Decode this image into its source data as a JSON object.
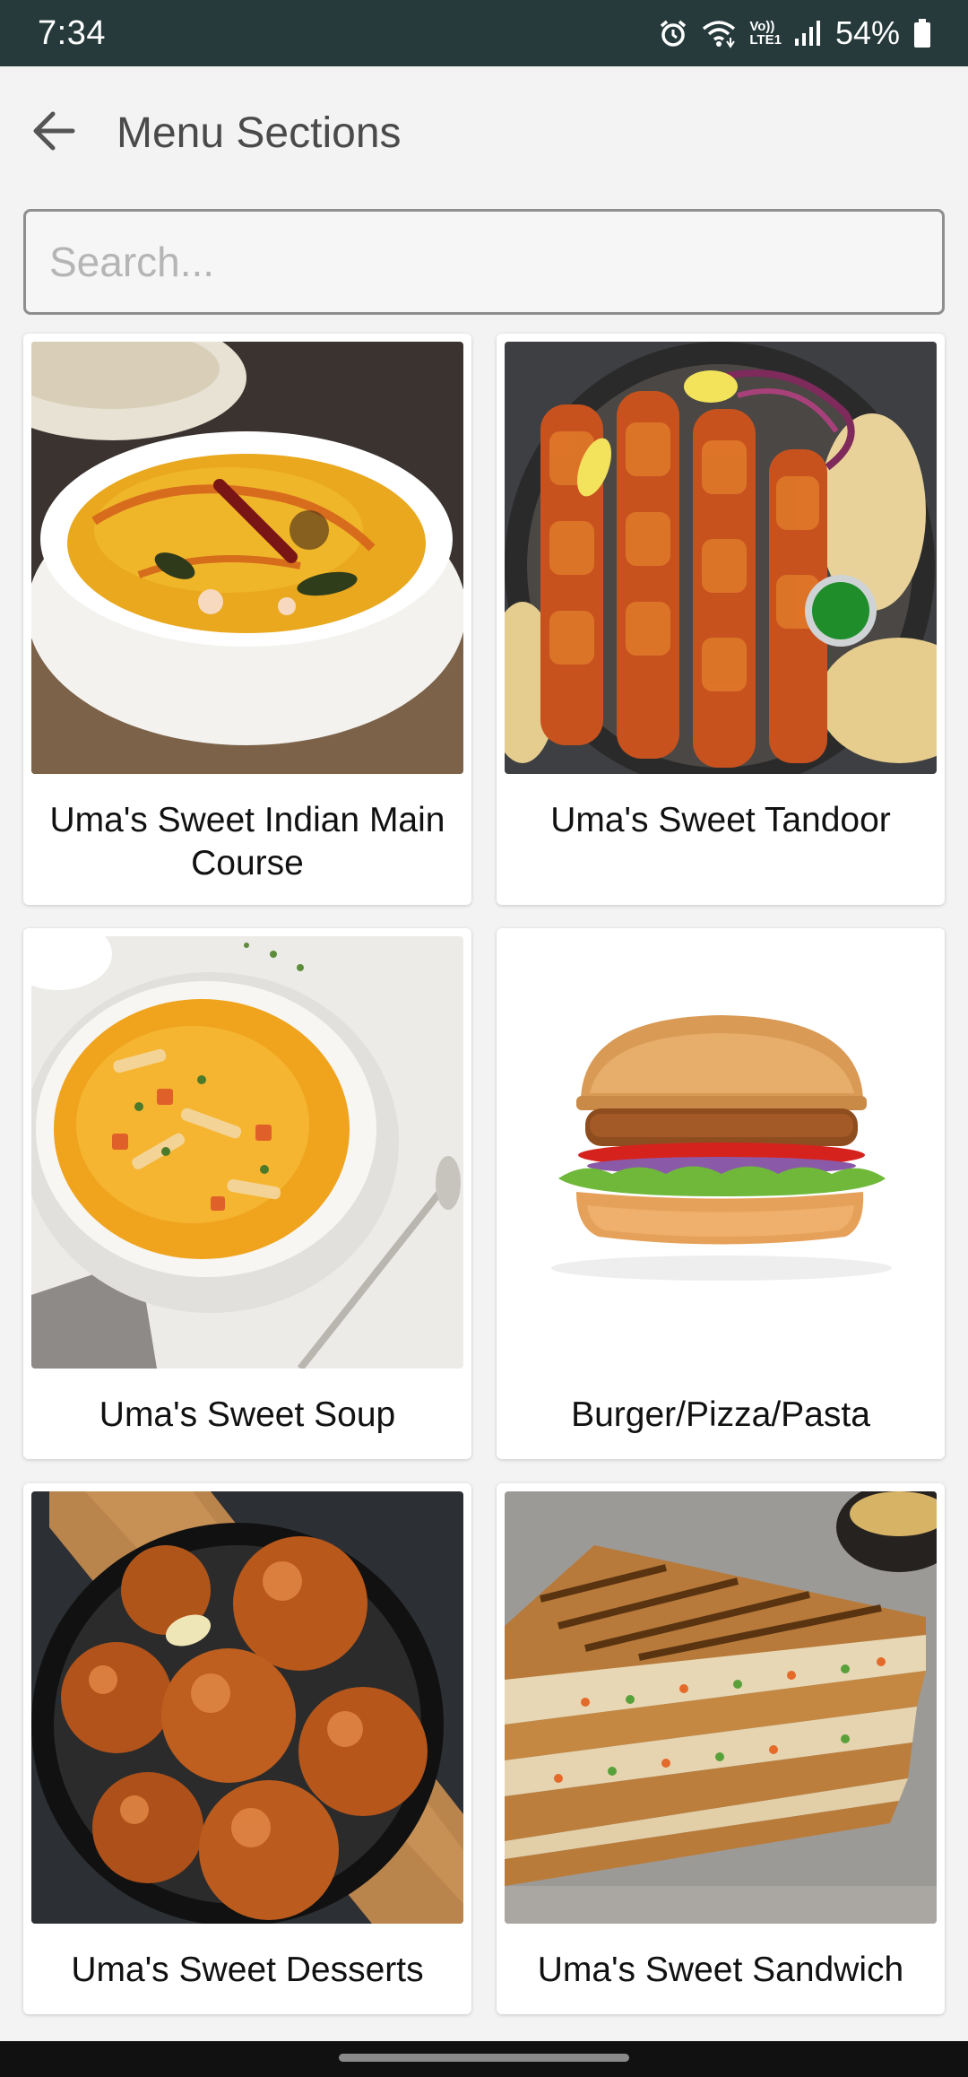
{
  "status_bar": {
    "time": "7:34",
    "battery": "54%",
    "icons": [
      "alarm-icon",
      "wifi-icon",
      "volte-icon",
      "signal-icon",
      "battery-icon"
    ],
    "volte_top": "Vo))",
    "volte_bottom": "LTE1"
  },
  "app_bar": {
    "back_icon": "arrow-left-icon",
    "title": "Menu Sections"
  },
  "search": {
    "placeholder": "Search...",
    "value": ""
  },
  "sections": [
    {
      "label": "Uma's Sweet Indian Main Course",
      "image": "dal-bowl"
    },
    {
      "label": "Uma's Sweet Tandoor",
      "image": "paneer-tikka-skewers"
    },
    {
      "label": "Uma's Sweet Soup",
      "image": "vegetable-soup-bowl"
    },
    {
      "label": "Burger/Pizza/Pasta",
      "image": "veg-burger"
    },
    {
      "label": "Uma's Sweet Desserts",
      "image": "gulab-jamun"
    },
    {
      "label": "Uma's Sweet Sandwich",
      "image": "grilled-sandwich"
    }
  ],
  "colors": {
    "status_bar_bg": "#263a3c",
    "page_bg": "#f3f3f3",
    "card_bg": "#ffffff",
    "title_text": "#4a4a4a"
  }
}
